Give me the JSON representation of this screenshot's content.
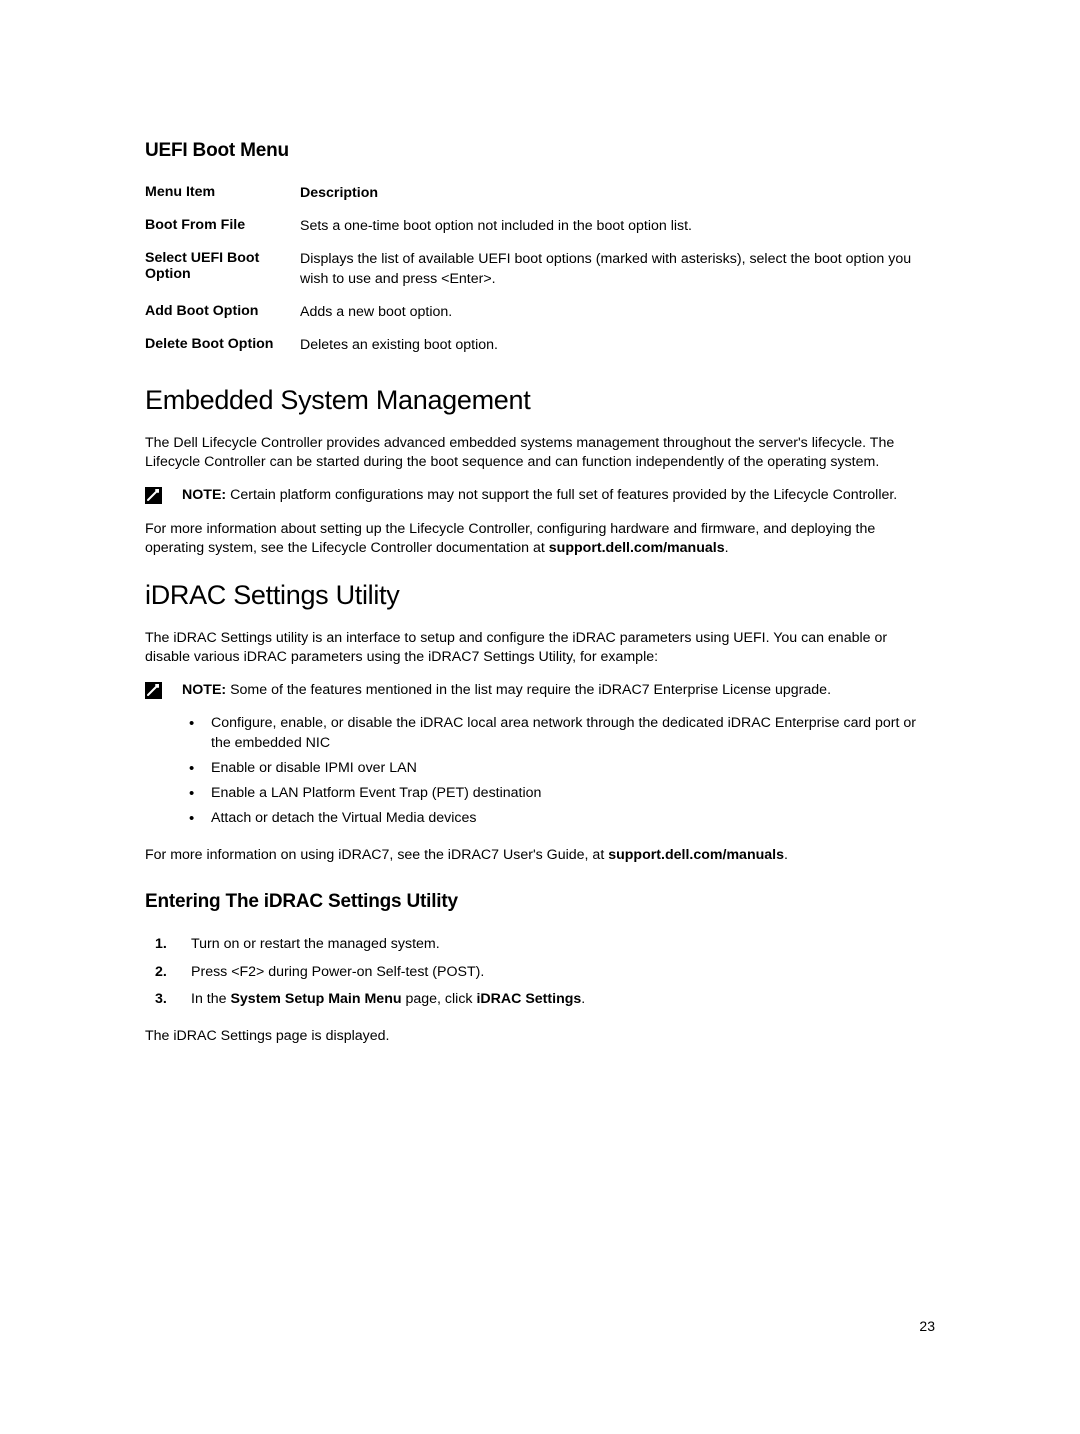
{
  "uefi": {
    "heading": "UEFI Boot Menu",
    "col1": "Menu Item",
    "col2": "Description",
    "rows": [
      {
        "item": "Boot From File",
        "desc": "Sets a one-time boot option not included in the boot option list."
      },
      {
        "item": "Select UEFI Boot Option",
        "desc": "Displays the list of available UEFI boot options (marked with asterisks), select the boot option you wish to use and press <Enter>."
      },
      {
        "item": "Add Boot Option",
        "desc": "Adds a new boot option."
      },
      {
        "item": "Delete Boot Option",
        "desc": "Deletes an existing boot option."
      }
    ]
  },
  "embedded": {
    "heading": "Embedded System Management",
    "p1": "The Dell Lifecycle Controller provides advanced embedded systems management throughout the server's lifecycle. The Lifecycle Controller can be started during the boot sequence and can function independently of the operating system.",
    "note_label": "NOTE:",
    "note_text": " Certain platform configurations may not support the full set of features provided by the Lifecycle Controller.",
    "p2a": "For more information about setting up the Lifecycle Controller, configuring hardware and firmware, and deploying the operating system, see the Lifecycle Controller documentation at ",
    "p2b": "support.dell.com/manuals",
    "p2c": "."
  },
  "idrac": {
    "heading": "iDRAC Settings Utility",
    "p1": "The iDRAC Settings utility is an interface to setup and configure the iDRAC parameters using UEFI. You can enable or disable various iDRAC parameters using the iDRAC7 Settings Utility, for example:",
    "note_label": "NOTE:",
    "note_text": " Some of the features mentioned in the list may require the iDRAC7 Enterprise License upgrade.",
    "bullets": [
      "Configure, enable, or disable the iDRAC local area network through the dedicated iDRAC Enterprise card port or the embedded NIC",
      "Enable or disable IPMI over LAN",
      "Enable a LAN Platform Event Trap (PET) destination",
      "Attach or detach the Virtual Media devices"
    ],
    "p2a": "For more information on using iDRAC7, see the iDRAC7 User's Guide, at ",
    "p2b": "support.dell.com/manuals",
    "p2c": "."
  },
  "entering": {
    "heading": "Entering The iDRAC Settings Utility",
    "steps": {
      "s1_num": "1.",
      "s1_txt": "Turn on or restart the managed system.",
      "s2_num": "2.",
      "s2_txt": "Press <F2> during Power-on Self-test (POST).",
      "s3_num": "3.",
      "s3_txt_a": "In the ",
      "s3_txt_b": "System Setup Main Menu",
      "s3_txt_c": " page, click ",
      "s3_txt_d": "iDRAC Settings",
      "s3_txt_e": "."
    },
    "closing": "The iDRAC Settings page is displayed."
  },
  "page_number": "23"
}
